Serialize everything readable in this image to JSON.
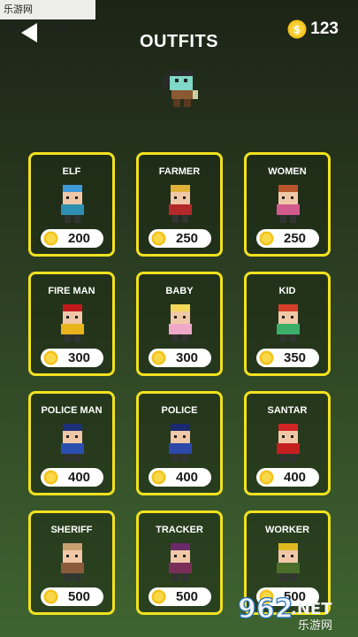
{
  "watermark_top": "乐游网 www.962.net",
  "header": {
    "title": "OUTFITS",
    "coin_balance": "123"
  },
  "outfits": [
    {
      "name": "ELF",
      "price": "200",
      "body": "#2f8fb0",
      "head": "#3f9ad8"
    },
    {
      "name": "FARMER",
      "price": "250",
      "body": "#b22a2a",
      "head": "#e0b23a"
    },
    {
      "name": "WOMEN",
      "price": "250",
      "body": "#d35a8f",
      "head": "#b8552a"
    },
    {
      "name": "FIRE MAN",
      "price": "300",
      "body": "#e8b41c",
      "head": "#c01a1a"
    },
    {
      "name": "BABY",
      "price": "300",
      "body": "#f0a8c8",
      "head": "#f3d85a"
    },
    {
      "name": "KID",
      "price": "350",
      "body": "#3cae6a",
      "head": "#d6402a"
    },
    {
      "name": "POLICE MAN",
      "price": "400",
      "body": "#2a4fb0",
      "head": "#1d2f78"
    },
    {
      "name": "POLICE",
      "price": "400",
      "body": "#2c48a8",
      "head": "#1b2a70"
    },
    {
      "name": "SANTAR",
      "price": "400",
      "body": "#c42020",
      "head": "#d22424"
    },
    {
      "name": "SHERIFF",
      "price": "500",
      "body": "#8a5a3a",
      "head": "#c8a070"
    },
    {
      "name": "TRACKER",
      "price": "500",
      "body": "#7a2f58",
      "head": "#6a2a6a"
    },
    {
      "name": "WORKER",
      "price": "500",
      "body": "#4a6e2a",
      "head": "#e0b820"
    }
  ],
  "watermark_bottom": {
    "brand": "962",
    "suffix": ".NET",
    "sub": "乐游网"
  },
  "colors": {
    "card_border": "#f2e120",
    "coin": "#f4c21a"
  }
}
